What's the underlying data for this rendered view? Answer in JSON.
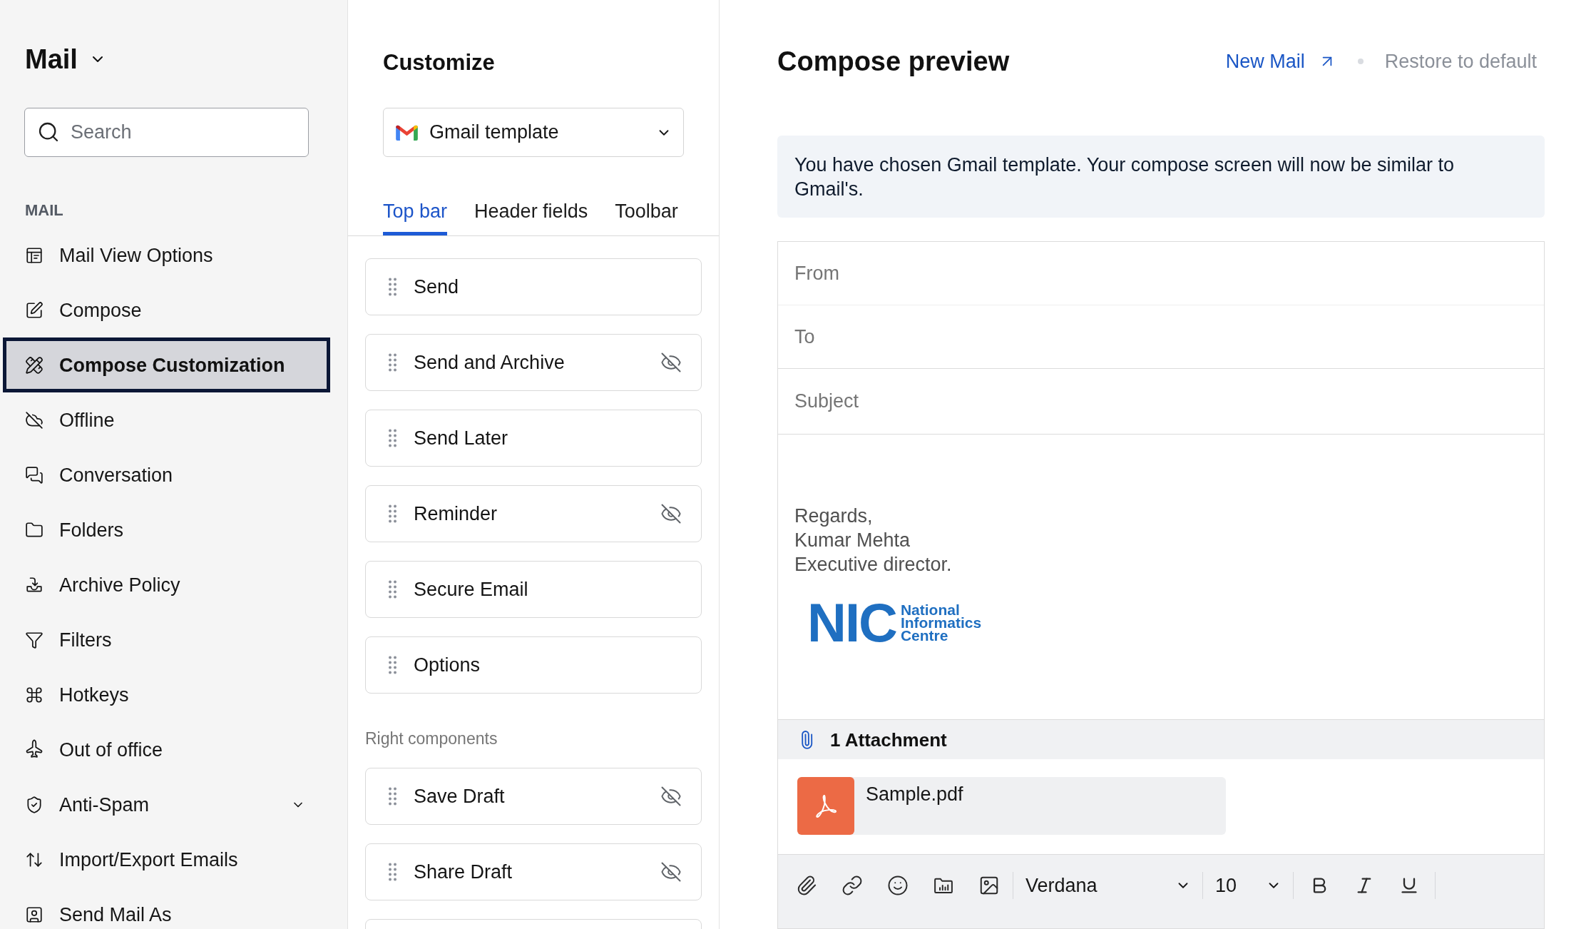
{
  "sidebar": {
    "title": "Mail",
    "search": {
      "placeholder": "Search"
    },
    "section": "MAIL",
    "items": [
      {
        "label": "Mail View Options",
        "kind": "link",
        "selected": false
      },
      {
        "label": "Compose",
        "kind": "link",
        "selected": false
      },
      {
        "label": "Compose Customization",
        "kind": "link",
        "selected": true
      },
      {
        "label": "Offline",
        "kind": "link",
        "selected": false
      },
      {
        "label": "Conversation",
        "kind": "link",
        "selected": false
      },
      {
        "label": "Folders",
        "kind": "link",
        "selected": false
      },
      {
        "label": "Archive Policy",
        "kind": "link",
        "selected": false
      },
      {
        "label": "Filters",
        "kind": "link",
        "selected": false
      },
      {
        "label": "Hotkeys",
        "kind": "link",
        "selected": false
      },
      {
        "label": "Out of office",
        "kind": "link",
        "selected": false
      },
      {
        "label": "Anti-Spam",
        "kind": "group",
        "selected": false
      },
      {
        "label": "Import/Export Emails",
        "kind": "link",
        "selected": false
      },
      {
        "label": "Send Mail As",
        "kind": "link",
        "selected": false
      }
    ]
  },
  "customize": {
    "title": "Customize",
    "template": {
      "value": "Gmail template"
    },
    "tabs": [
      {
        "label": "Top bar",
        "selected": true
      },
      {
        "label": "Header fields",
        "selected": false
      },
      {
        "label": "Toolbar",
        "selected": false
      }
    ],
    "components": [
      {
        "label": "Send",
        "hidden": false
      },
      {
        "label": "Send and Archive",
        "hidden": true
      },
      {
        "label": "Send Later",
        "hidden": false
      },
      {
        "label": "Reminder",
        "hidden": true
      },
      {
        "label": "Secure Email",
        "hidden": false
      },
      {
        "label": "Options",
        "hidden": false
      }
    ],
    "right_components": {
      "heading": "Right components",
      "items": [
        {
          "label": "Save Draft",
          "hidden": true
        },
        {
          "label": "Share Draft",
          "hidden": true
        }
      ]
    }
  },
  "preview": {
    "title": "Compose preview",
    "new_mail_link": "New Mail",
    "restore": {
      "label": "Restore to default",
      "disabled": true
    },
    "notice": "You have chosen Gmail template. Your compose screen will now be similar to Gmail's.",
    "fields": [
      {
        "placeholder": "From"
      },
      {
        "placeholder": "To"
      },
      {
        "placeholder": "Subject"
      }
    ],
    "signature_lines": [
      "Regards,",
      "Kumar Mehta",
      "Executive director."
    ],
    "logo": {
      "mark": "NIC",
      "name": "National Informatics Centre"
    },
    "attachments": {
      "heading": "1 Attachment",
      "files": [
        {
          "name": "Sample.pdf"
        }
      ]
    },
    "toolbar": {
      "font": "Verdana",
      "size": "10"
    }
  }
}
